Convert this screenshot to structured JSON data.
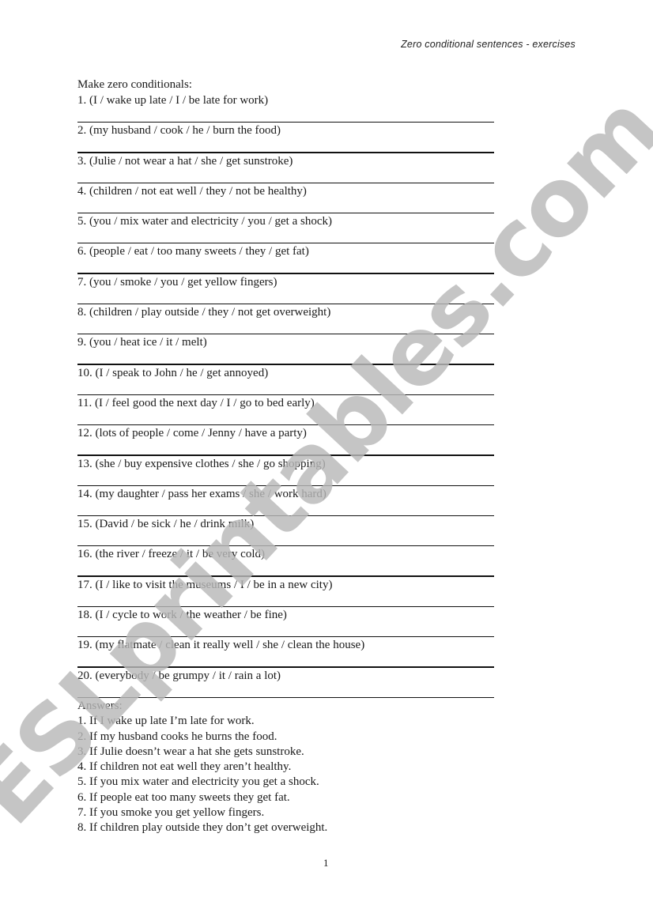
{
  "header": {
    "title": "Zero conditional sentences - exercises"
  },
  "instructions": "Make zero conditionals:",
  "exercises": [
    "1. (I / wake up late / I / be late for work)",
    "2. (my husband / cook / he / burn the food)",
    "3. (Julie / not wear a hat / she / get sunstroke)",
    "4. (children / not eat well / they / not be healthy)",
    "5. (you / mix water and electricity / you / get a shock)",
    "6. (people / eat / too many sweets / they / get fat)",
    "7. (you / smoke / you / get yellow fingers)",
    "8. (children / play outside / they / not get overweight)",
    "9. (you / heat ice / it / melt)",
    "10. (I / speak to John / he / get annoyed)",
    "11. (I / feel good the next day / I / go to bed early)",
    "12. (lots of people / come / Jenny / have a party)",
    "13. (she / buy expensive clothes / she / go shopping)",
    "14. (my daughter / pass her exams / she / work hard)",
    "15. (David / be sick / he / drink milk)",
    "16. (the river / freeze / it / be very cold)",
    "17. (I / like to visit the museums / I / be in a new city)",
    "18. (I / cycle to work / the weather / be fine)",
    "19. (my flatmate / clean it really well / she / clean the house)",
    "20. (everybody / be grumpy / it / rain a lot)"
  ],
  "answers": {
    "title": "Answers:",
    "items": [
      "1. If I wake up late I’m late for work.",
      "2. If my husband cooks he burns the food.",
      "3. If Julie doesn’t wear a hat she gets sunstroke.",
      "4. If children not eat well they aren’t healthy.",
      "5. If you mix water and electricity you get a shock.",
      "6. If people eat too many sweets they get fat.",
      "7. If you smoke you get yellow fingers.",
      "8. If children play outside they don’t get overweight."
    ]
  },
  "page_number": "1",
  "watermark": {
    "text": "ESLprintables.com",
    "color": "#b9b9b9"
  }
}
